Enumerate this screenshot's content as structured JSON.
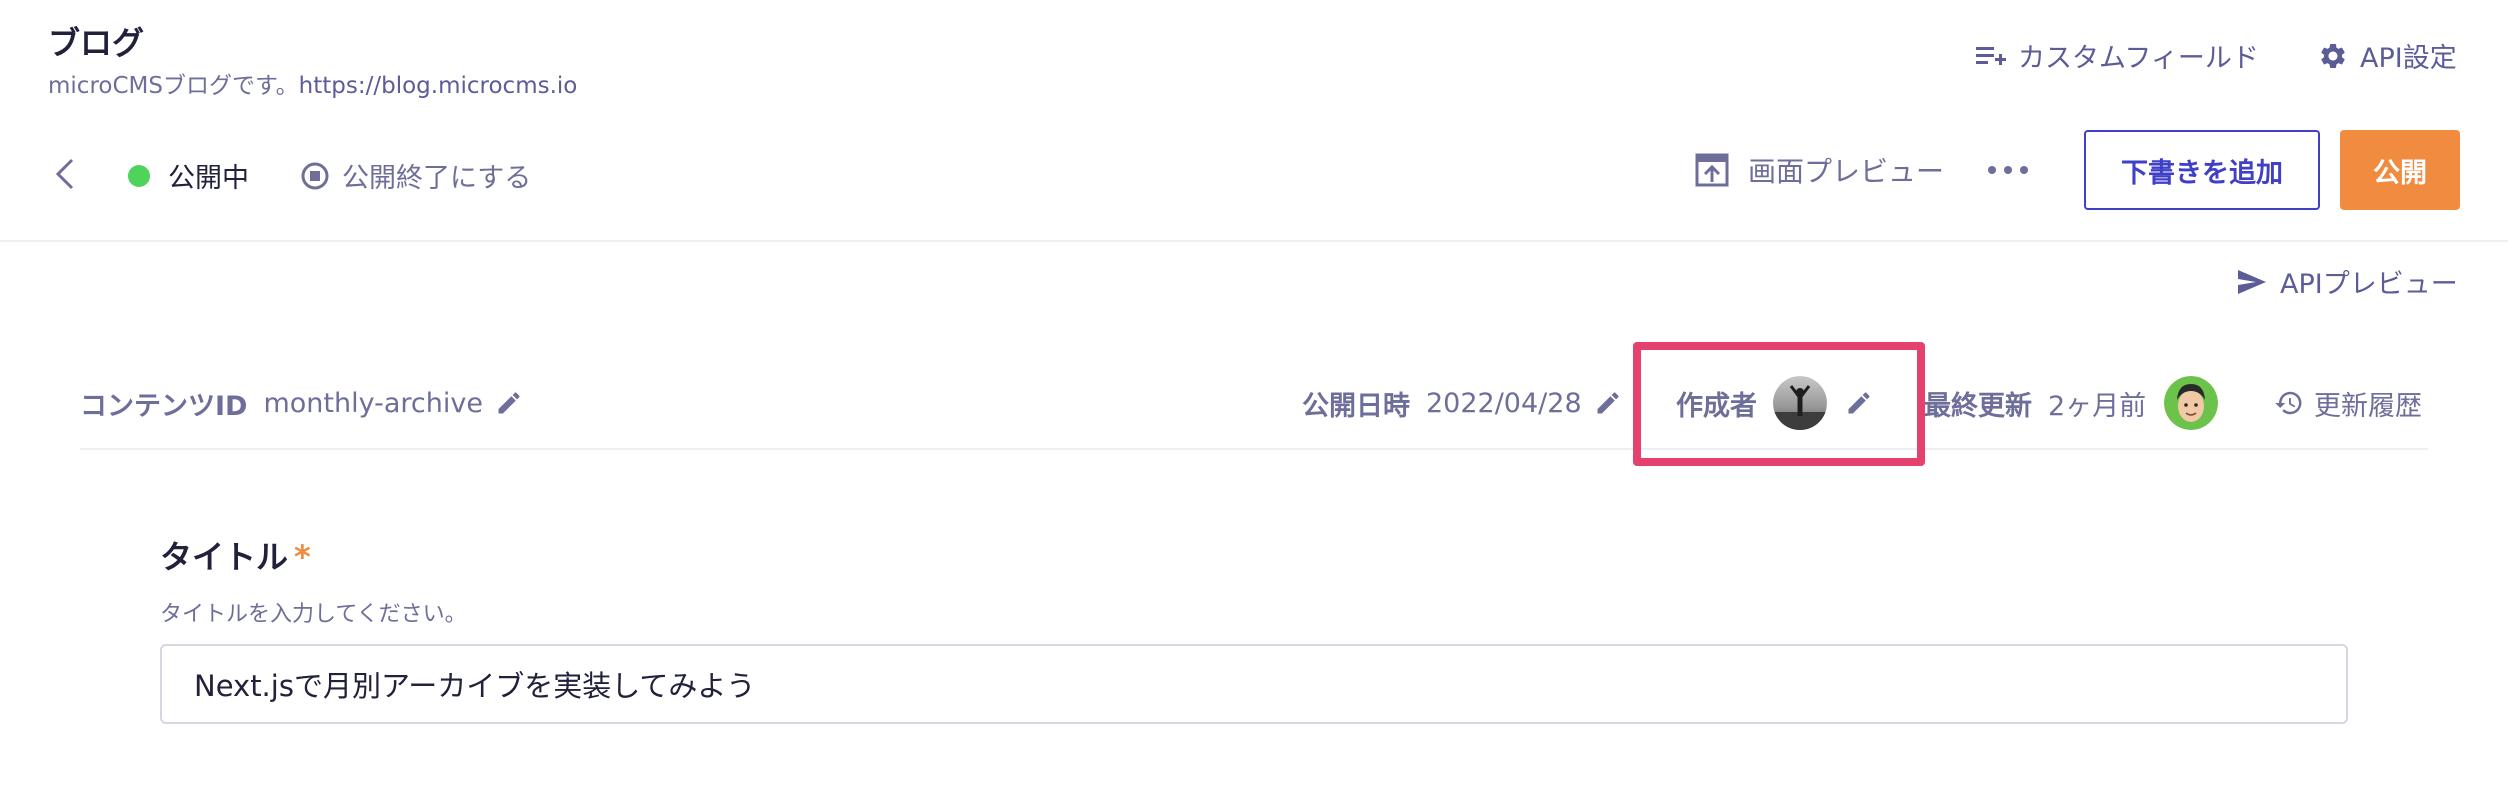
{
  "app": {
    "title": "ブログ",
    "description": "microCMSブログです。",
    "url": "https://blog.microcms.io"
  },
  "top_links": {
    "custom_fields": "カスタムフィールド",
    "api_settings": "API設定"
  },
  "toolbar": {
    "status": "公開中",
    "unpublish": "公開終了にする",
    "screen_preview": "画面プレビュー",
    "add_draft": "下書きを追加",
    "publish": "公開",
    "api_preview": "APIプレビュー"
  },
  "meta": {
    "content_id_label": "コンテンツID",
    "content_id_value": "monthly-archive",
    "published_at_label": "公開日時",
    "published_at_value": "2022/04/28",
    "author_label": "作成者",
    "last_updated_label": "最終更新",
    "last_updated_value": "2ヶ月前",
    "history": "更新履歴"
  },
  "form": {
    "title_label": "タイトル",
    "required_mark": "*",
    "title_hint": "タイトルを入力してください。",
    "title_value": "Next.jsで月別アーカイブを実装してみよう"
  },
  "colors": {
    "primary": "#3f3fc7",
    "publish": "#f08b3f",
    "status_green": "#4fd35a",
    "highlight": "#e5416f"
  },
  "icons": [
    "list-add-icon",
    "gear-icon",
    "chevron-left-icon",
    "stop-circle-icon",
    "preview-upload-icon",
    "more-icon",
    "send-icon",
    "pencil-icon",
    "history-icon"
  ]
}
